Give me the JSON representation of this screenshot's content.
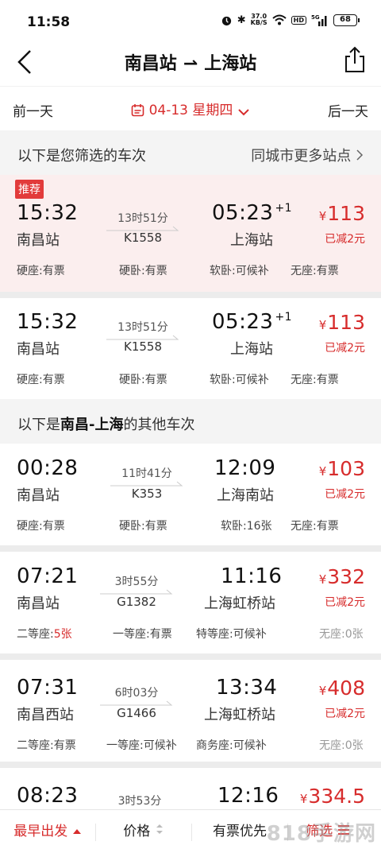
{
  "status": {
    "time": "11:58",
    "speed_top": "37.0",
    "speed_unit": "KB/S",
    "hd": "HD",
    "net": "5G",
    "battery": "68"
  },
  "nav": {
    "from": "南昌站",
    "arrow": "⇀",
    "to": "上海站"
  },
  "date_bar": {
    "prev": "前一天",
    "date": "04-13 星期四",
    "next": "后一天"
  },
  "filtered_header": {
    "label": "以下是您筛选的车次",
    "more": "同城市更多站点"
  },
  "other_header": {
    "prefix": "以下是",
    "route": "南昌-上海",
    "suffix": "的其他车次"
  },
  "badge": "推荐",
  "trains": [
    {
      "dep_time": "15:32",
      "dep_station": "南昌站",
      "duration": "13时51分",
      "train_no": "K1558",
      "arr_time": "05:23",
      "arr_day": "+1",
      "arr_station": "上海站",
      "yen": "¥",
      "price": "113",
      "discount": "已减2元",
      "seats": [
        {
          "name": "硬座:",
          "status": "有票"
        },
        {
          "name": "硬卧:",
          "status": "有票"
        },
        {
          "name": "软卧:",
          "status": "可候补"
        },
        {
          "name": "无座:",
          "status": "有票"
        }
      ]
    },
    {
      "dep_time": "15:32",
      "dep_station": "南昌站",
      "duration": "13时51分",
      "train_no": "K1558",
      "arr_time": "05:23",
      "arr_day": "+1",
      "arr_station": "上海站",
      "yen": "¥",
      "price": "113",
      "discount": "已减2元",
      "seats": [
        {
          "name": "硬座:",
          "status": "有票"
        },
        {
          "name": "硬卧:",
          "status": "有票"
        },
        {
          "name": "软卧:",
          "status": "可候补"
        },
        {
          "name": "无座:",
          "status": "有票"
        }
      ]
    },
    {
      "dep_time": "00:28",
      "dep_station": "南昌站",
      "duration": "11时41分",
      "train_no": "K353",
      "arr_time": "12:09",
      "arr_day": "",
      "arr_station": "上海南站",
      "yen": "¥",
      "price": "103",
      "discount": "已减2元",
      "seats": [
        {
          "name": "硬座:",
          "status": "有票"
        },
        {
          "name": "硬卧:",
          "status": "有票"
        },
        {
          "name": "软卧:",
          "status": "16张"
        },
        {
          "name": "无座:",
          "status": "有票"
        }
      ]
    },
    {
      "dep_time": "07:21",
      "dep_station": "南昌站",
      "duration": "3时55分",
      "train_no": "G1382",
      "arr_time": "11:16",
      "arr_day": "",
      "arr_station": "上海虹桥站",
      "yen": "¥",
      "price": "332",
      "discount": "已减2元",
      "seats": [
        {
          "name": "二等座:",
          "status": "5张"
        },
        {
          "name": "一等座:",
          "status": "有票"
        },
        {
          "name": "特等座:",
          "status": "可候补"
        },
        {
          "name": "无座:",
          "status": "0张"
        }
      ]
    },
    {
      "dep_time": "07:31",
      "dep_station": "南昌西站",
      "duration": "6时03分",
      "train_no": "G1466",
      "arr_time": "13:34",
      "arr_day": "",
      "arr_station": "上海虹桥站",
      "yen": "¥",
      "price": "408",
      "discount": "已减2元",
      "seats": [
        {
          "name": "二等座:",
          "status": "有票"
        },
        {
          "name": "一等座:",
          "status": "可候补"
        },
        {
          "name": "商务座:",
          "status": "可候补"
        },
        {
          "name": "无座:",
          "status": "0张"
        }
      ]
    },
    {
      "dep_time": "08:23",
      "dep_station": "",
      "duration": "3时53分",
      "train_no": "",
      "arr_time": "12:16",
      "arr_day": "",
      "arr_station": "",
      "yen": "¥",
      "price": "334.5",
      "discount": "",
      "seats": []
    }
  ],
  "bottom_tabs": {
    "earliest": "最早出发",
    "price": "价格",
    "available": "有票优先",
    "filter": "筛选"
  },
  "watermark": "818手游网",
  "colors": {
    "accent": "#d72c2c",
    "highlight_bg": "#fbeeee",
    "section_bg": "#f4f4f4"
  }
}
